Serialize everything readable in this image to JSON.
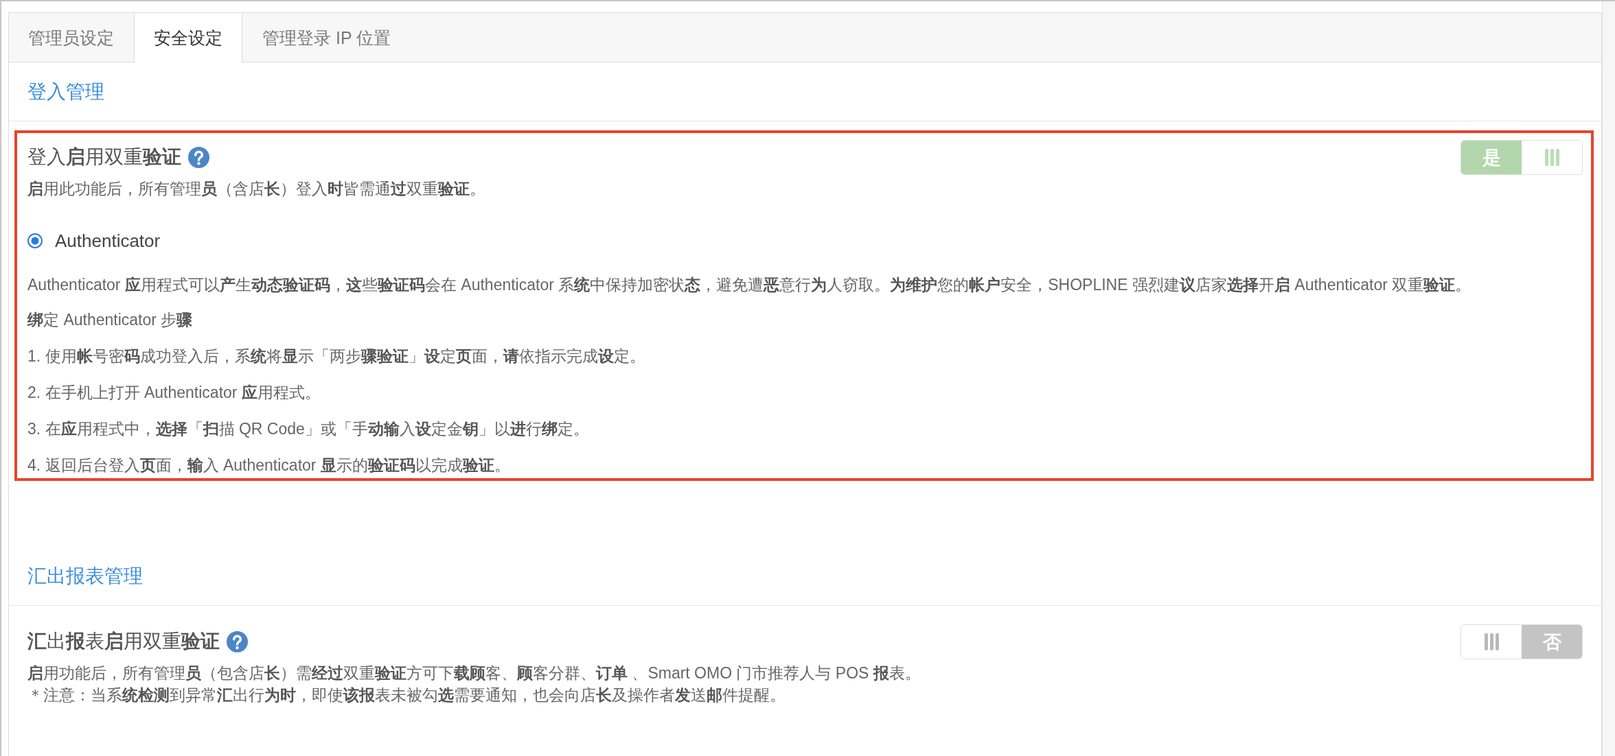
{
  "tabs": [
    {
      "label": "管理员设定",
      "selected": false
    },
    {
      "label": "安全设定",
      "selected": true
    },
    {
      "label": "管理登录 IP 位置",
      "selected": false
    }
  ],
  "sections": [
    {
      "heading": "登入管理",
      "highlighted": true,
      "setting": {
        "title": "登入**启**用双重**验证**",
        "description": [
          "**启**用此功能后，所有管理**员**（含店**长**）登入**时**皆需通**过**双重**验证**。"
        ],
        "toggle": {
          "on": true,
          "label": "是"
        }
      },
      "options": [
        {
          "label": "Authenticator",
          "selected": true
        }
      ],
      "intro": "Authenticator **应**用程式可以**产**生**动态验证码**，**这**些**验证码**会在 Authenticator 系**统**中保持加密状**态**，避免遭**恶**意行**为**人窃取。**为维护**您的**帐户**安全，SHOPLINE 强烈建**议**店家**选择**开**启** Authenticator 双重**验证**。",
      "steps_title": "**绑**定 Authenticator 步**骤**",
      "steps": [
        "1. 使用**帐**号密**码**成功登入后，系**统**将**显**示「两步**骤验证**」**设**定**页**面，**请**依指示完成**设**定。",
        "2. 在手机上打开 Authenticator **应**用程式。",
        "3. 在**应**用程式中，**选择**「**扫**描 QR Code」或「手**动输**入**设**定金**钥**」以**进**行**绑**定。",
        "4. 返回后台登入**页**面，**输**入 Authenticator **显**示的**验证码**以完成**验证**。"
      ]
    },
    {
      "heading": "汇出报表管理",
      "highlighted": false,
      "setting": {
        "title": "**汇**出**报**表**启**用双重**验证**",
        "description": [
          "**启**用功能后，所有管理**员**（包含店**长**）需**经过**双重**验证**方可下**载顾**客、**顾**客分群、**订单** 、Smart OMO 门市推荐人与 POS **报**表。",
          "＊注意：当系**统检测**到异常**汇**出行**为时**，即使**该报**表未被勾**选**需要通知，也会向店**长**及操作者**发**送**邮**件提醒。"
        ],
        "toggle": {
          "on": false,
          "label": "否"
        }
      }
    }
  ]
}
